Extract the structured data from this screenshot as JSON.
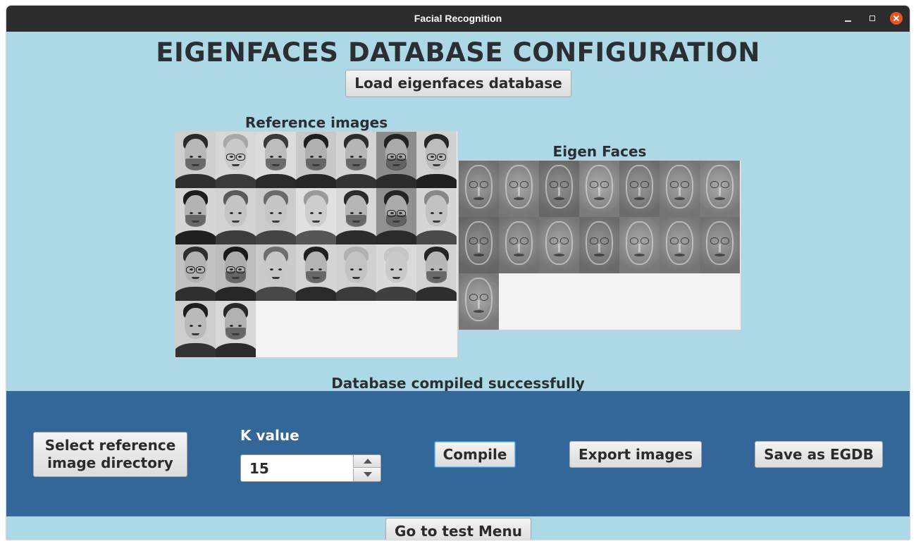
{
  "window": {
    "title": "Facial Recognition"
  },
  "page": {
    "title": "EIGENFACES DATABASE CONFIGURATION",
    "load_button": "Load eigenfaces database",
    "reference_label": "Reference images",
    "eigen_label": "Eigen Faces",
    "status": "Database compiled successfully"
  },
  "reference_images": [
    {
      "skin": "#b8b8b8",
      "hair": "#2a2a2a",
      "bg": "#cfcfcf",
      "glasses": false,
      "beard": true,
      "shirt": "#2f2f2f"
    },
    {
      "skin": "#c9c9c9",
      "hair": "#a8a8a8",
      "bg": "#d8d8d8",
      "glasses": true,
      "beard": false,
      "shirt": "#3a3a3a"
    },
    {
      "skin": "#bdbdbd",
      "hair": "#3a3a3a",
      "bg": "#dcdcdc",
      "glasses": false,
      "beard": true,
      "shirt": "#2a2a2a"
    },
    {
      "skin": "#b0b0b0",
      "hair": "#1e1e1e",
      "bg": "#c8c8c8",
      "glasses": false,
      "beard": true,
      "shirt": "#262626"
    },
    {
      "skin": "#b6b6b6",
      "hair": "#2d2d2d",
      "bg": "#d4d4d4",
      "glasses": false,
      "beard": true,
      "shirt": "#333333"
    },
    {
      "skin": "#aaaaaa",
      "hair": "#222222",
      "bg": "#8c8c8c",
      "glasses": true,
      "beard": true,
      "shirt": "#2b2b2b"
    },
    {
      "skin": "#bcbcbc",
      "hair": "#262626",
      "bg": "#d0d0d0",
      "glasses": true,
      "beard": false,
      "shirt": "#1f1f1f"
    },
    {
      "skin": "#b3b3b3",
      "hair": "#1c1c1c",
      "bg": "#d6d6d6",
      "glasses": false,
      "beard": true,
      "shirt": "#202020"
    },
    {
      "skin": "#c4c4c4",
      "hair": "#5a5a5a",
      "bg": "#d2d2d2",
      "glasses": false,
      "beard": false,
      "shirt": "#3c3c3c"
    },
    {
      "skin": "#c6c6c6",
      "hair": "#6a6a6a",
      "bg": "#cccccc",
      "glasses": false,
      "beard": false,
      "shirt": "#444444"
    },
    {
      "skin": "#cdcdcd",
      "hair": "#9a9a9a",
      "bg": "#e0e0e0",
      "glasses": false,
      "beard": false,
      "shirt": "#555555"
    },
    {
      "skin": "#b5b5b5",
      "hair": "#2a2a2a",
      "bg": "#d8d8d8",
      "glasses": false,
      "beard": true,
      "shirt": "#2c2c2c"
    },
    {
      "skin": "#ababab",
      "hair": "#242424",
      "bg": "#909090",
      "glasses": true,
      "beard": true,
      "shirt": "#2a2a2a"
    },
    {
      "skin": "#c2c2c2",
      "hair": "#888888",
      "bg": "#d6d6d6",
      "glasses": false,
      "beard": false,
      "shirt": "#4a4a4a"
    },
    {
      "skin": "#b2b2b2",
      "hair": "#2e2e2e",
      "bg": "#c2c2c2",
      "glasses": true,
      "beard": false,
      "shirt": "#303030"
    },
    {
      "skin": "#adadad",
      "hair": "#1a1a1a",
      "bg": "#bcbcbc",
      "glasses": true,
      "beard": true,
      "shirt": "#262626"
    },
    {
      "skin": "#c8c8c8",
      "hair": "#6e6e6e",
      "bg": "#cacaca",
      "glasses": false,
      "beard": false,
      "shirt": "#484848"
    },
    {
      "skin": "#b4b4b4",
      "hair": "#1f1f1f",
      "bg": "#d4d4d4",
      "glasses": false,
      "beard": true,
      "shirt": "#2a2a2a"
    },
    {
      "skin": "#c3c3c3",
      "hair": "#b0b0b0",
      "bg": "#d0d0d0",
      "glasses": false,
      "beard": false,
      "shirt": "#3a3a3a"
    },
    {
      "skin": "#cacaca",
      "hair": "#c6c6c6",
      "bg": "#dadada",
      "glasses": false,
      "beard": false,
      "shirt": "#3f3f3f"
    },
    {
      "skin": "#b7b7b7",
      "hair": "#252525",
      "bg": "#d2d2d2",
      "glasses": false,
      "beard": true,
      "shirt": "#2e2e2e"
    },
    {
      "skin": "#bababa",
      "hair": "#1e1e1e",
      "bg": "#cecece",
      "glasses": false,
      "beard": false,
      "shirt": "#333333"
    },
    {
      "skin": "#b1b1b1",
      "hair": "#282828",
      "bg": "#d8d8d8",
      "glasses": false,
      "beard": true,
      "shirt": "#2b2b2b"
    }
  ],
  "eigen_faces_count": 15,
  "bottom": {
    "select_button": "Select reference image directory",
    "k_label": "K value",
    "k_value": "15",
    "compile_button": "Compile",
    "export_button": "Export images",
    "save_button": "Save as EGDB"
  },
  "footer": {
    "test_button": "Go to test Menu"
  },
  "colors": {
    "background": "#add8e6",
    "bottom_panel": "#336699",
    "titlebar": "#2c2c2c",
    "close_button": "#e95420"
  }
}
